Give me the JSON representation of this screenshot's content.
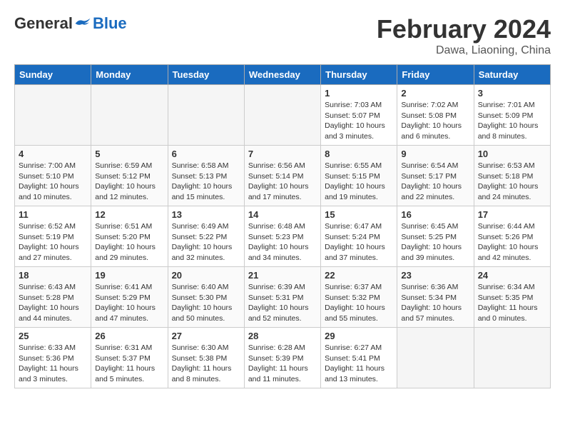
{
  "header": {
    "logo_general": "General",
    "logo_blue": "Blue",
    "month_year": "February 2024",
    "location": "Dawa, Liaoning, China"
  },
  "calendar": {
    "days_of_week": [
      "Sunday",
      "Monday",
      "Tuesday",
      "Wednesday",
      "Thursday",
      "Friday",
      "Saturday"
    ],
    "weeks": [
      [
        {
          "day": "",
          "info": ""
        },
        {
          "day": "",
          "info": ""
        },
        {
          "day": "",
          "info": ""
        },
        {
          "day": "",
          "info": ""
        },
        {
          "day": "1",
          "info": "Sunrise: 7:03 AM\nSunset: 5:07 PM\nDaylight: 10 hours\nand 3 minutes."
        },
        {
          "day": "2",
          "info": "Sunrise: 7:02 AM\nSunset: 5:08 PM\nDaylight: 10 hours\nand 6 minutes."
        },
        {
          "day": "3",
          "info": "Sunrise: 7:01 AM\nSunset: 5:09 PM\nDaylight: 10 hours\nand 8 minutes."
        }
      ],
      [
        {
          "day": "4",
          "info": "Sunrise: 7:00 AM\nSunset: 5:10 PM\nDaylight: 10 hours\nand 10 minutes."
        },
        {
          "day": "5",
          "info": "Sunrise: 6:59 AM\nSunset: 5:12 PM\nDaylight: 10 hours\nand 12 minutes."
        },
        {
          "day": "6",
          "info": "Sunrise: 6:58 AM\nSunset: 5:13 PM\nDaylight: 10 hours\nand 15 minutes."
        },
        {
          "day": "7",
          "info": "Sunrise: 6:56 AM\nSunset: 5:14 PM\nDaylight: 10 hours\nand 17 minutes."
        },
        {
          "day": "8",
          "info": "Sunrise: 6:55 AM\nSunset: 5:15 PM\nDaylight: 10 hours\nand 19 minutes."
        },
        {
          "day": "9",
          "info": "Sunrise: 6:54 AM\nSunset: 5:17 PM\nDaylight: 10 hours\nand 22 minutes."
        },
        {
          "day": "10",
          "info": "Sunrise: 6:53 AM\nSunset: 5:18 PM\nDaylight: 10 hours\nand 24 minutes."
        }
      ],
      [
        {
          "day": "11",
          "info": "Sunrise: 6:52 AM\nSunset: 5:19 PM\nDaylight: 10 hours\nand 27 minutes."
        },
        {
          "day": "12",
          "info": "Sunrise: 6:51 AM\nSunset: 5:20 PM\nDaylight: 10 hours\nand 29 minutes."
        },
        {
          "day": "13",
          "info": "Sunrise: 6:49 AM\nSunset: 5:22 PM\nDaylight: 10 hours\nand 32 minutes."
        },
        {
          "day": "14",
          "info": "Sunrise: 6:48 AM\nSunset: 5:23 PM\nDaylight: 10 hours\nand 34 minutes."
        },
        {
          "day": "15",
          "info": "Sunrise: 6:47 AM\nSunset: 5:24 PM\nDaylight: 10 hours\nand 37 minutes."
        },
        {
          "day": "16",
          "info": "Sunrise: 6:45 AM\nSunset: 5:25 PM\nDaylight: 10 hours\nand 39 minutes."
        },
        {
          "day": "17",
          "info": "Sunrise: 6:44 AM\nSunset: 5:26 PM\nDaylight: 10 hours\nand 42 minutes."
        }
      ],
      [
        {
          "day": "18",
          "info": "Sunrise: 6:43 AM\nSunset: 5:28 PM\nDaylight: 10 hours\nand 44 minutes."
        },
        {
          "day": "19",
          "info": "Sunrise: 6:41 AM\nSunset: 5:29 PM\nDaylight: 10 hours\nand 47 minutes."
        },
        {
          "day": "20",
          "info": "Sunrise: 6:40 AM\nSunset: 5:30 PM\nDaylight: 10 hours\nand 50 minutes."
        },
        {
          "day": "21",
          "info": "Sunrise: 6:39 AM\nSunset: 5:31 PM\nDaylight: 10 hours\nand 52 minutes."
        },
        {
          "day": "22",
          "info": "Sunrise: 6:37 AM\nSunset: 5:32 PM\nDaylight: 10 hours\nand 55 minutes."
        },
        {
          "day": "23",
          "info": "Sunrise: 6:36 AM\nSunset: 5:34 PM\nDaylight: 10 hours\nand 57 minutes."
        },
        {
          "day": "24",
          "info": "Sunrise: 6:34 AM\nSunset: 5:35 PM\nDaylight: 11 hours\nand 0 minutes."
        }
      ],
      [
        {
          "day": "25",
          "info": "Sunrise: 6:33 AM\nSunset: 5:36 PM\nDaylight: 11 hours\nand 3 minutes."
        },
        {
          "day": "26",
          "info": "Sunrise: 6:31 AM\nSunset: 5:37 PM\nDaylight: 11 hours\nand 5 minutes."
        },
        {
          "day": "27",
          "info": "Sunrise: 6:30 AM\nSunset: 5:38 PM\nDaylight: 11 hours\nand 8 minutes."
        },
        {
          "day": "28",
          "info": "Sunrise: 6:28 AM\nSunset: 5:39 PM\nDaylight: 11 hours\nand 11 minutes."
        },
        {
          "day": "29",
          "info": "Sunrise: 6:27 AM\nSunset: 5:41 PM\nDaylight: 11 hours\nand 13 minutes."
        },
        {
          "day": "",
          "info": ""
        },
        {
          "day": "",
          "info": ""
        }
      ]
    ]
  }
}
